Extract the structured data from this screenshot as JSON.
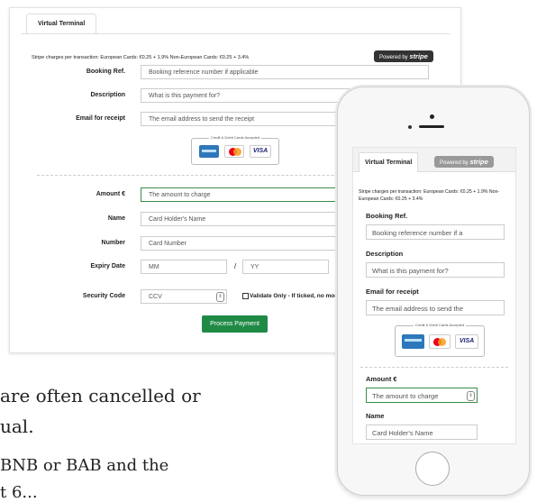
{
  "desktop": {
    "tab_label": "Virtual Terminal",
    "charges_text": "Stripe charges per transaction: European Cards: €0.25 + 1.9% Non-European Cards: €0.25 + 3.4%",
    "stripe_badge": {
      "prefix": "Powered by",
      "brand": "stripe"
    },
    "fields": {
      "booking_ref": {
        "label": "Booking Ref.",
        "placeholder": "Booking reference number if applicable"
      },
      "description": {
        "label": "Description",
        "placeholder": "What is this payment for?"
      },
      "email": {
        "label": "Email for receipt",
        "placeholder": "The email address to send the receipt"
      },
      "amount": {
        "label": "Amount  €",
        "placeholder": "The amount to charge"
      },
      "name": {
        "label": "Name",
        "placeholder": "Card Holder's Name"
      },
      "number": {
        "label": "Number",
        "placeholder": "Card Number"
      },
      "expiry": {
        "label": "Expiry Date",
        "month_placeholder": "MM",
        "separator": "/",
        "year_placeholder": "YY"
      },
      "security": {
        "label": "Security Code",
        "placeholder": "CCV"
      }
    },
    "cards_accepted": "Credit & Debit Cards Accepted",
    "card_visa": "VISA",
    "validate_text": "Validate Only - If ticked, no mor card",
    "process_button": "Process Payment"
  },
  "background_text": {
    "line1": "are often cancelled or",
    "line2": "ual.",
    "line3": "BNB or BAB and the",
    "line4": "t 6..."
  },
  "mobile": {
    "tab_label": "Virtual Terminal",
    "stripe_badge": {
      "prefix": "Powered by",
      "brand": "stripe"
    },
    "charges_text": "Stripe charges per transaction: European Cards: €0.25 + 1.9% Non-European Cards: €0.25 + 3.4%",
    "fields": {
      "booking_ref": {
        "label": "Booking Ref.",
        "placeholder": "Booking reference number if a"
      },
      "description": {
        "label": "Description",
        "placeholder": "What is this payment for?"
      },
      "email": {
        "label": "Email for receipt",
        "placeholder": "The email address to send the"
      },
      "amount": {
        "label": "Amount  €",
        "placeholder": "The amount to charge"
      },
      "name": {
        "label": "Name",
        "placeholder": "Card Holder's Name"
      }
    },
    "cards_accepted": "Credit & Debit Cards Accepted",
    "card_visa": "VISA"
  },
  "colors": {
    "accent_green": "#1f8a45",
    "stripe_dark": "#333333",
    "amex_blue": "#2e77bb"
  }
}
